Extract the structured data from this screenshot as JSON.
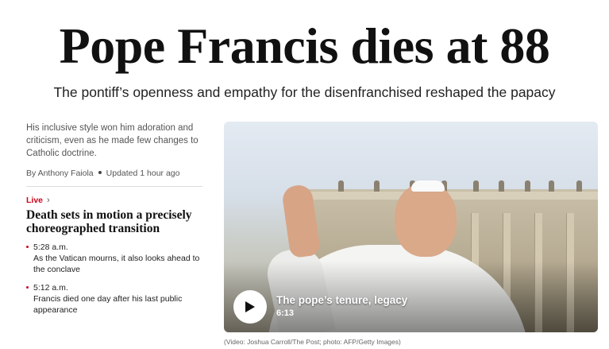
{
  "headline": "Pope Francis dies at 88",
  "subheadline": "The pontiff’s openness and empathy for the disenfranchised reshaped the papacy",
  "story": {
    "summary": "His inclusive style won him adoration and criticism, even as he made few changes to Catholic doctrine.",
    "author": "By Anthony Faiola",
    "updated": "Updated 1 hour ago"
  },
  "live": {
    "label": "Live",
    "chevron_icon": "chevron-right-icon",
    "title": "Death sets in motion a precisely choreographed transition",
    "updates": [
      {
        "time": "5:28 a.m.",
        "text": "As the Vatican mourns, it also looks ahead to the conclave"
      },
      {
        "time": "5:12 a.m.",
        "text": "Francis died one day after his last public appearance"
      }
    ]
  },
  "video": {
    "title": "The pope’s tenure, legacy",
    "duration": "6:13",
    "play_icon": "play-icon",
    "credit": "(Video: Joshua Carroll/The Post; photo: AFP/Getty Images)"
  },
  "colors": {
    "live_accent": "#d0021b",
    "text_primary": "#111111",
    "text_secondary": "#555555"
  }
}
